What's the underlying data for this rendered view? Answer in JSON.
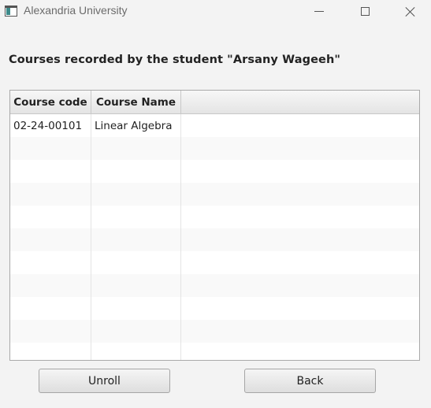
{
  "window": {
    "title": "Alexandria University",
    "icon": "app-window-icon",
    "controls": [
      "minimize-icon",
      "maximize-icon",
      "close-icon"
    ]
  },
  "heading": "Courses recorded by the student \"Arsany Wageeh\"",
  "table": {
    "columns": [
      "Course code",
      "Course Name",
      ""
    ],
    "rows": [
      [
        "02-24-00101",
        "Linear Algebra",
        ""
      ],
      [
        "",
        "",
        ""
      ],
      [
        "",
        "",
        ""
      ],
      [
        "",
        "",
        ""
      ],
      [
        "",
        "",
        ""
      ],
      [
        "",
        "",
        ""
      ],
      [
        "",
        "",
        ""
      ],
      [
        "",
        "",
        ""
      ],
      [
        "",
        "",
        ""
      ],
      [
        "",
        "",
        ""
      ],
      [
        "",
        "",
        ""
      ]
    ]
  },
  "buttons": {
    "unroll": "Unroll",
    "back": "Back"
  }
}
